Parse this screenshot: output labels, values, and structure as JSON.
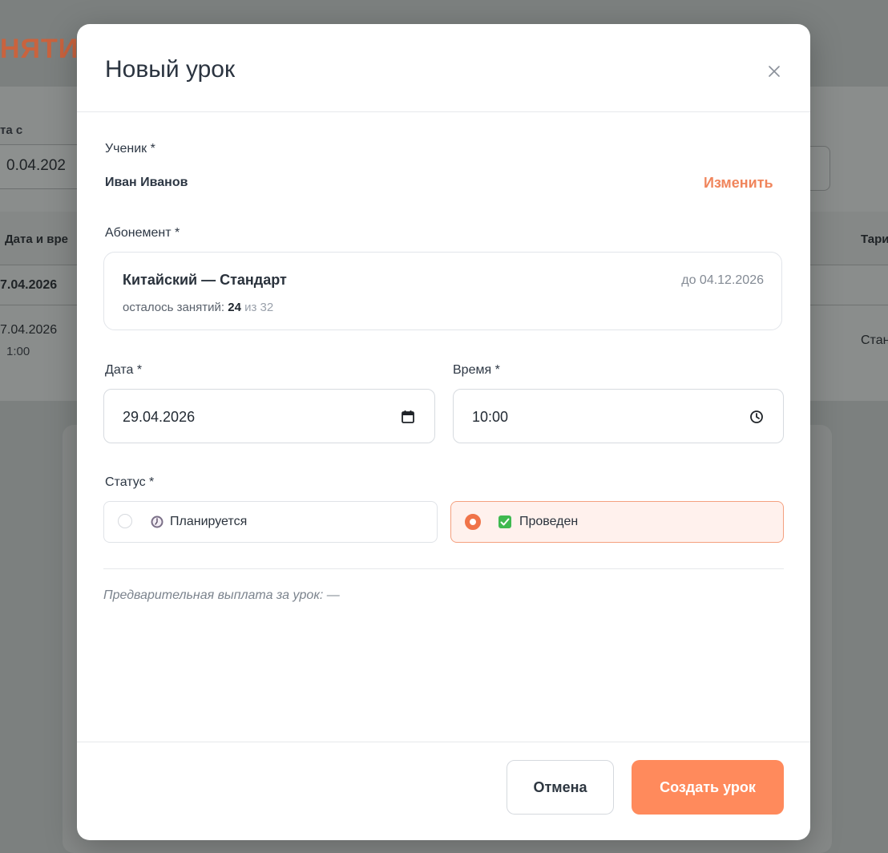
{
  "background": {
    "heading_fragment": "НЯТИ",
    "filter_label_fragment": "та с",
    "filter_date_fragment": "0.04.202",
    "table": {
      "col_datetime_fragment": "Дата и вре",
      "col_tariff_fragment": "Тари",
      "row1_date_fragment": "7.04.2026",
      "row2_date_fragment": "7.04.2026",
      "row2_time_fragment": "1:00",
      "row2_tariff_fragment": "Стан"
    }
  },
  "modal": {
    "title": "Новый урок",
    "close_icon": "close-icon",
    "student": {
      "label": "Ученик *",
      "name": "Иван Иванов",
      "change_label": "Изменить"
    },
    "subscription": {
      "label": "Абонемент *",
      "name": "Китайский — Стандарт",
      "until": "до 04.12.2026",
      "remaining_prefix": "осталось занятий:",
      "remaining": "24",
      "total": "из 32"
    },
    "date": {
      "label": "Дата *",
      "value": "29.04.2026",
      "icon": "calendar-icon"
    },
    "time": {
      "label": "Время *",
      "value": "10:00",
      "icon": "clock-icon"
    },
    "status": {
      "label": "Статус *",
      "options": [
        {
          "label": "Планируется",
          "icon": "clock-emoji-icon",
          "selected": false
        },
        {
          "label": "Проведен",
          "icon": "check-mark-icon",
          "selected": true
        }
      ]
    },
    "prepayment_text": "Предварительная выплата за урок: —",
    "footer": {
      "cancel_label": "Отмена",
      "create_label": "Создать урок"
    }
  },
  "colors": {
    "accent": "#ff8a5c",
    "accent_text": "#f0855c",
    "selected_bg": "#fff1ed",
    "overlay": "#7c807f"
  }
}
